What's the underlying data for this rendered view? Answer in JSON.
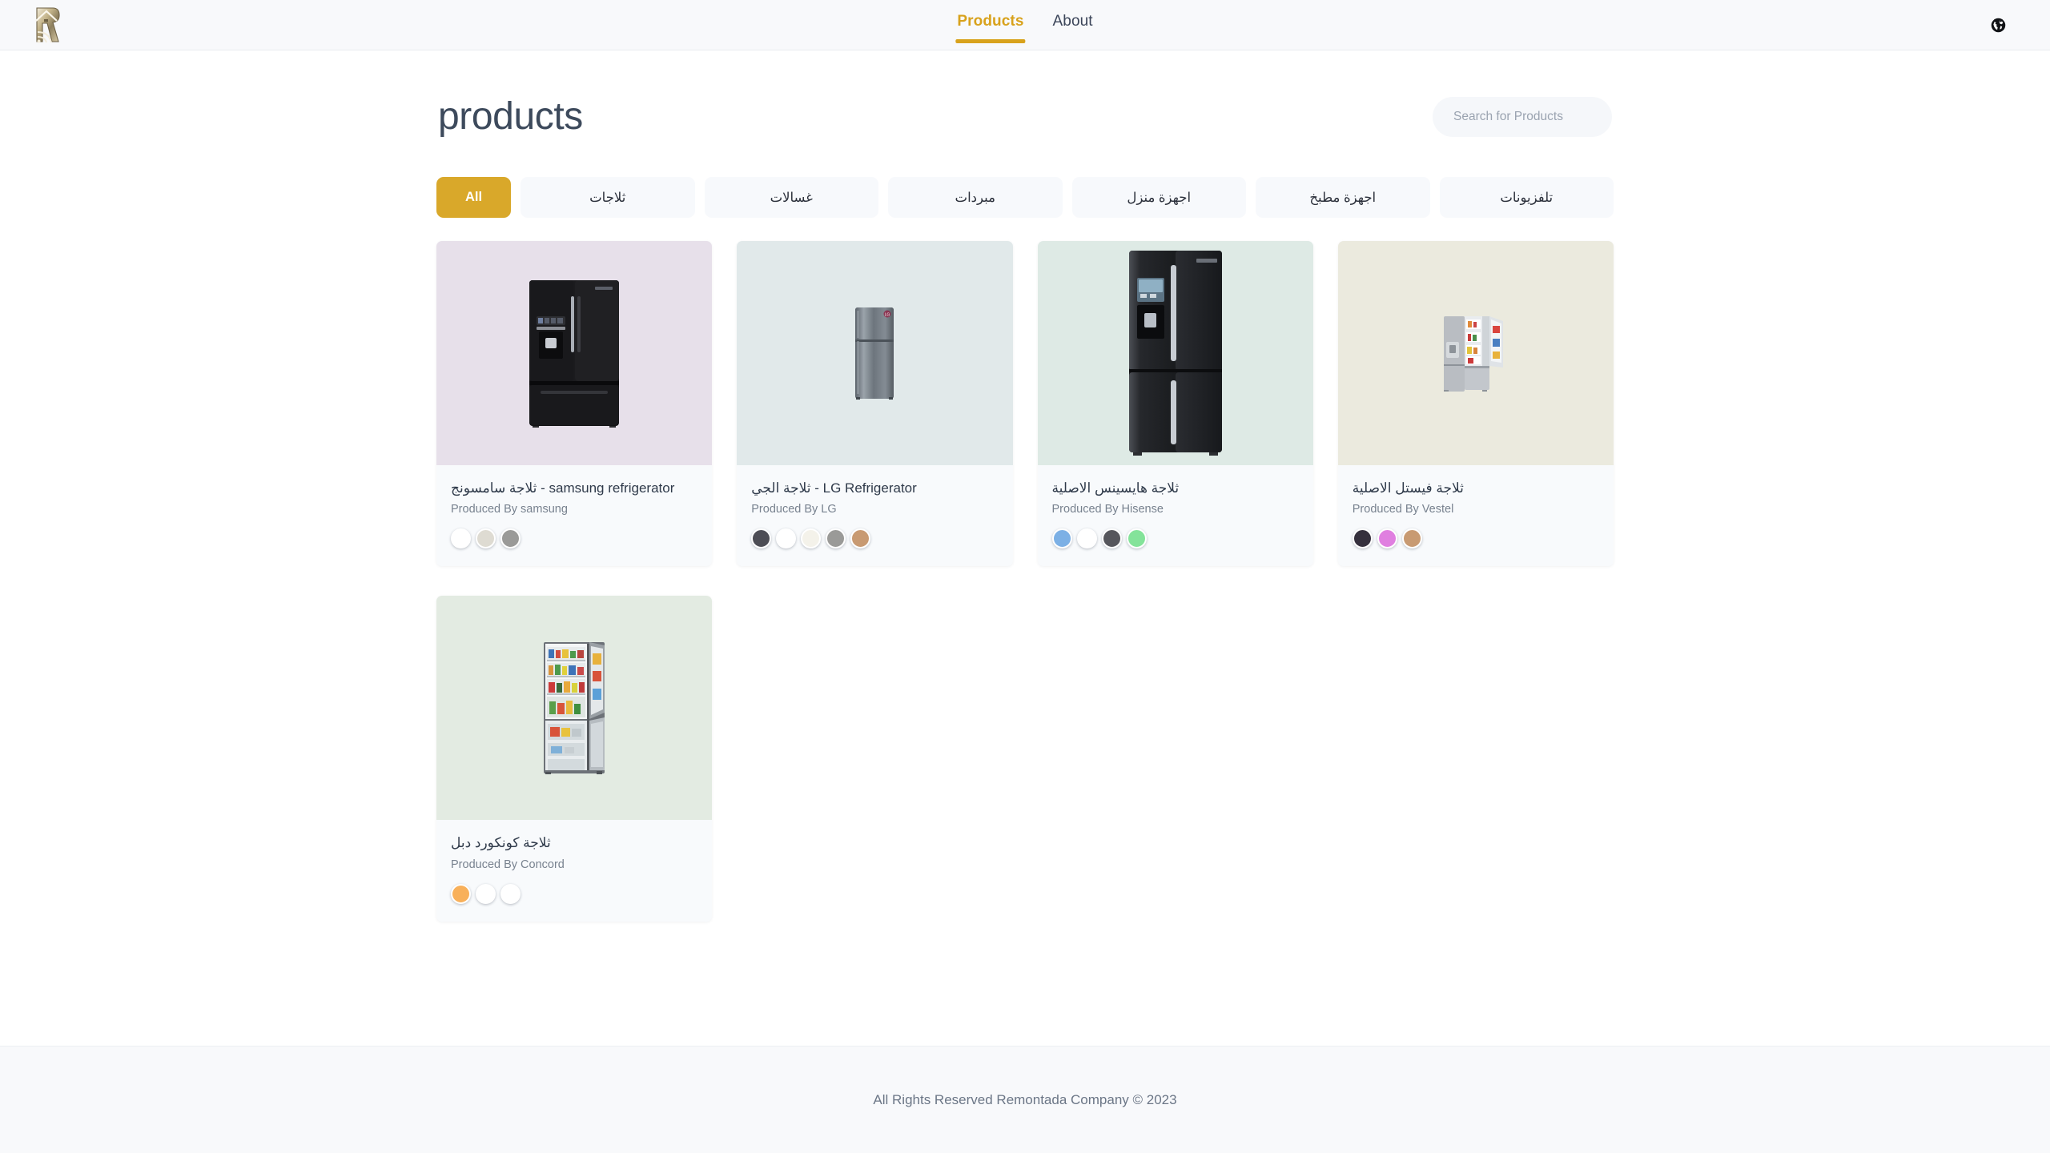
{
  "header": {
    "logo_name": "remontada-logo",
    "nav": [
      {
        "label": "Products",
        "active": true
      },
      {
        "label": "About",
        "active": false
      }
    ],
    "language_icon": "globe-icon",
    "accent_color": "#d8a21c"
  },
  "main": {
    "title": "products",
    "search": {
      "placeholder": "Search for Products",
      "value": ""
    },
    "categories": [
      {
        "label": "All",
        "active": true
      },
      {
        "label": "ثلاجات",
        "active": false
      },
      {
        "label": "غسالات",
        "active": false
      },
      {
        "label": "مبردات",
        "active": false
      },
      {
        "label": "اجهزة منزل",
        "active": false
      },
      {
        "label": "اجهزة مطبخ",
        "active": false
      },
      {
        "label": "تلفزيونات",
        "active": false
      }
    ],
    "products": [
      {
        "title": "ثلاجة سامسونج - samsung refrigerator",
        "subtitle": "Produced By samsung",
        "image_bg": "#e7e0ea",
        "image_name": "samsung-french-door-refrigerator-black",
        "colors": [
          "#ffffff",
          "#dedbd2",
          "#9a9a98"
        ]
      },
      {
        "title": "ثلاجة الجي - LG Refrigerator",
        "subtitle": "Produced By LG",
        "image_bg": "#e1e9ea",
        "image_name": "lg-top-freezer-refrigerator-steel",
        "colors": [
          "#4d4d55",
          "#ffffff",
          "#f4f2ea",
          "#9a9a98",
          "#c89a72"
        ]
      },
      {
        "title": "ثلاجة هايسينس الاصلية",
        "subtitle": "Produced By Hisense",
        "image_bg": "#deeae5",
        "image_name": "hisense-four-door-refrigerator-black",
        "colors": [
          "#7cb0e5",
          "#ffffff",
          "#56565c",
          "#84e39a"
        ]
      },
      {
        "title": "ثلاجة فيستل الاصلية",
        "subtitle": "Produced By Vestel",
        "image_bg": "#ebead e",
        "image_name": "vestel-open-door-refrigerator-steel",
        "colors": [
          "#35303d",
          "#e07fe0",
          "#c89a72"
        ]
      },
      {
        "title": "ثلاجة كونكورد دبل",
        "subtitle": "Produced By Concord",
        "image_bg": "#e3ebe2",
        "image_name": "concord-double-door-refrigerator-open",
        "colors": [
          "#f8b05a",
          "#ffffff",
          "#ffffff"
        ]
      }
    ]
  },
  "footer": {
    "text": "All Rights Reserved Remontada Company © 2023"
  }
}
